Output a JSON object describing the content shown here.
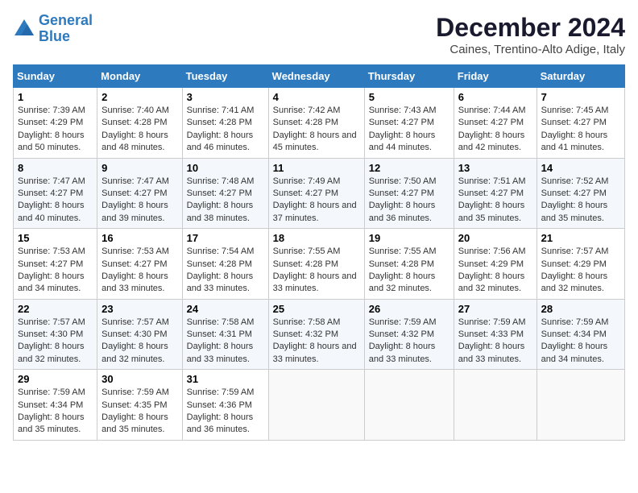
{
  "header": {
    "logo_line1": "General",
    "logo_line2": "Blue",
    "title": "December 2024",
    "subtitle": "Caines, Trentino-Alto Adige, Italy"
  },
  "columns": [
    "Sunday",
    "Monday",
    "Tuesday",
    "Wednesday",
    "Thursday",
    "Friday",
    "Saturday"
  ],
  "weeks": [
    [
      {
        "day": "1",
        "sunrise": "Sunrise: 7:39 AM",
        "sunset": "Sunset: 4:29 PM",
        "daylight": "Daylight: 8 hours and 50 minutes."
      },
      {
        "day": "2",
        "sunrise": "Sunrise: 7:40 AM",
        "sunset": "Sunset: 4:28 PM",
        "daylight": "Daylight: 8 hours and 48 minutes."
      },
      {
        "day": "3",
        "sunrise": "Sunrise: 7:41 AM",
        "sunset": "Sunset: 4:28 PM",
        "daylight": "Daylight: 8 hours and 46 minutes."
      },
      {
        "day": "4",
        "sunrise": "Sunrise: 7:42 AM",
        "sunset": "Sunset: 4:28 PM",
        "daylight": "Daylight: 8 hours and 45 minutes."
      },
      {
        "day": "5",
        "sunrise": "Sunrise: 7:43 AM",
        "sunset": "Sunset: 4:27 PM",
        "daylight": "Daylight: 8 hours and 44 minutes."
      },
      {
        "day": "6",
        "sunrise": "Sunrise: 7:44 AM",
        "sunset": "Sunset: 4:27 PM",
        "daylight": "Daylight: 8 hours and 42 minutes."
      },
      {
        "day": "7",
        "sunrise": "Sunrise: 7:45 AM",
        "sunset": "Sunset: 4:27 PM",
        "daylight": "Daylight: 8 hours and 41 minutes."
      }
    ],
    [
      {
        "day": "8",
        "sunrise": "Sunrise: 7:47 AM",
        "sunset": "Sunset: 4:27 PM",
        "daylight": "Daylight: 8 hours and 40 minutes."
      },
      {
        "day": "9",
        "sunrise": "Sunrise: 7:47 AM",
        "sunset": "Sunset: 4:27 PM",
        "daylight": "Daylight: 8 hours and 39 minutes."
      },
      {
        "day": "10",
        "sunrise": "Sunrise: 7:48 AM",
        "sunset": "Sunset: 4:27 PM",
        "daylight": "Daylight: 8 hours and 38 minutes."
      },
      {
        "day": "11",
        "sunrise": "Sunrise: 7:49 AM",
        "sunset": "Sunset: 4:27 PM",
        "daylight": "Daylight: 8 hours and 37 minutes."
      },
      {
        "day": "12",
        "sunrise": "Sunrise: 7:50 AM",
        "sunset": "Sunset: 4:27 PM",
        "daylight": "Daylight: 8 hours and 36 minutes."
      },
      {
        "day": "13",
        "sunrise": "Sunrise: 7:51 AM",
        "sunset": "Sunset: 4:27 PM",
        "daylight": "Daylight: 8 hours and 35 minutes."
      },
      {
        "day": "14",
        "sunrise": "Sunrise: 7:52 AM",
        "sunset": "Sunset: 4:27 PM",
        "daylight": "Daylight: 8 hours and 35 minutes."
      }
    ],
    [
      {
        "day": "15",
        "sunrise": "Sunrise: 7:53 AM",
        "sunset": "Sunset: 4:27 PM",
        "daylight": "Daylight: 8 hours and 34 minutes."
      },
      {
        "day": "16",
        "sunrise": "Sunrise: 7:53 AM",
        "sunset": "Sunset: 4:27 PM",
        "daylight": "Daylight: 8 hours and 33 minutes."
      },
      {
        "day": "17",
        "sunrise": "Sunrise: 7:54 AM",
        "sunset": "Sunset: 4:28 PM",
        "daylight": "Daylight: 8 hours and 33 minutes."
      },
      {
        "day": "18",
        "sunrise": "Sunrise: 7:55 AM",
        "sunset": "Sunset: 4:28 PM",
        "daylight": "Daylight: 8 hours and 33 minutes."
      },
      {
        "day": "19",
        "sunrise": "Sunrise: 7:55 AM",
        "sunset": "Sunset: 4:28 PM",
        "daylight": "Daylight: 8 hours and 32 minutes."
      },
      {
        "day": "20",
        "sunrise": "Sunrise: 7:56 AM",
        "sunset": "Sunset: 4:29 PM",
        "daylight": "Daylight: 8 hours and 32 minutes."
      },
      {
        "day": "21",
        "sunrise": "Sunrise: 7:57 AM",
        "sunset": "Sunset: 4:29 PM",
        "daylight": "Daylight: 8 hours and 32 minutes."
      }
    ],
    [
      {
        "day": "22",
        "sunrise": "Sunrise: 7:57 AM",
        "sunset": "Sunset: 4:30 PM",
        "daylight": "Daylight: 8 hours and 32 minutes."
      },
      {
        "day": "23",
        "sunrise": "Sunrise: 7:57 AM",
        "sunset": "Sunset: 4:30 PM",
        "daylight": "Daylight: 8 hours and 32 minutes."
      },
      {
        "day": "24",
        "sunrise": "Sunrise: 7:58 AM",
        "sunset": "Sunset: 4:31 PM",
        "daylight": "Daylight: 8 hours and 33 minutes."
      },
      {
        "day": "25",
        "sunrise": "Sunrise: 7:58 AM",
        "sunset": "Sunset: 4:32 PM",
        "daylight": "Daylight: 8 hours and 33 minutes."
      },
      {
        "day": "26",
        "sunrise": "Sunrise: 7:59 AM",
        "sunset": "Sunset: 4:32 PM",
        "daylight": "Daylight: 8 hours and 33 minutes."
      },
      {
        "day": "27",
        "sunrise": "Sunrise: 7:59 AM",
        "sunset": "Sunset: 4:33 PM",
        "daylight": "Daylight: 8 hours and 33 minutes."
      },
      {
        "day": "28",
        "sunrise": "Sunrise: 7:59 AM",
        "sunset": "Sunset: 4:34 PM",
        "daylight": "Daylight: 8 hours and 34 minutes."
      }
    ],
    [
      {
        "day": "29",
        "sunrise": "Sunrise: 7:59 AM",
        "sunset": "Sunset: 4:34 PM",
        "daylight": "Daylight: 8 hours and 35 minutes."
      },
      {
        "day": "30",
        "sunrise": "Sunrise: 7:59 AM",
        "sunset": "Sunset: 4:35 PM",
        "daylight": "Daylight: 8 hours and 35 minutes."
      },
      {
        "day": "31",
        "sunrise": "Sunrise: 7:59 AM",
        "sunset": "Sunset: 4:36 PM",
        "daylight": "Daylight: 8 hours and 36 minutes."
      },
      null,
      null,
      null,
      null
    ]
  ]
}
